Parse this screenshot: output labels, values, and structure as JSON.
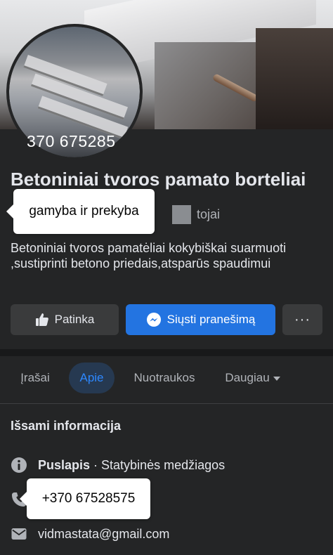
{
  "profile": {
    "avatar_text": "370 675285",
    "page_name": "Betoniniai tvoros pamato borteliai",
    "category_partial": "tojai",
    "description": "Betoniniai tvoros pamatėliai kokybiškai suarmuoti ,sustiprinti betono priedais,atsparūs spaudimui"
  },
  "tooltips": {
    "category": "gamyba ir prekyba",
    "phone": "+370 67528575"
  },
  "actions": {
    "like": "Patinka",
    "message": "Siųsti pranešimą",
    "more": "···"
  },
  "tabs": [
    {
      "label": "Įrašai"
    },
    {
      "label": "Apie"
    },
    {
      "label": "Nuotraukos"
    },
    {
      "label": "Daugiau"
    }
  ],
  "details": {
    "title": "Išsami informacija",
    "page_label": "Puslapis",
    "page_category": "· Statybinės medžiagos",
    "email": "vidmastata@gmail.com"
  },
  "colors": {
    "background": "#242526",
    "accent": "#2374e1",
    "active_tab_bg": "#263951",
    "active_tab_text": "#2d88ff"
  },
  "icons": [
    "like-icon",
    "messenger-icon",
    "info-icon",
    "phone-icon",
    "mail-icon",
    "chevron-down-icon"
  ]
}
